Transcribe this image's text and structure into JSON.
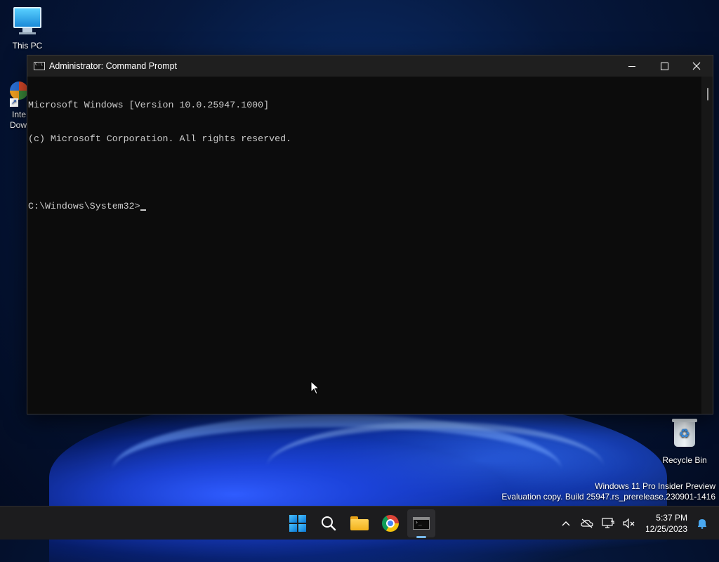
{
  "desktop": {
    "icons": [
      {
        "label": "This PC",
        "icon": "monitor-icon"
      },
      {
        "label": "Recycle Bin",
        "icon": "recycle-bin-icon"
      }
    ],
    "partial_icon": {
      "line1": "Inte",
      "line2": "Dow",
      "icon": "app-shortcut-icon"
    },
    "watermark": {
      "line1": "Windows 11 Pro Insider Preview",
      "line2": "Evaluation copy. Build 25947.rs_prerelease.230901-1416"
    }
  },
  "window": {
    "title": "Administrator: Command Prompt",
    "icon": "cmd-icon",
    "controls": {
      "minimize": "minimize-icon",
      "maximize": "maximize-icon",
      "close": "close-icon"
    },
    "console_lines": [
      "Microsoft Windows [Version 10.0.25947.1000]",
      "(c) Microsoft Corporation. All rights reserved.",
      "",
      "C:\\Windows\\System32>"
    ]
  },
  "taskbar": {
    "apps": [
      {
        "name": "Start",
        "icon": "windows-start-icon"
      },
      {
        "name": "Search",
        "icon": "search-icon"
      },
      {
        "name": "File Explorer",
        "icon": "folder-icon"
      },
      {
        "name": "Google Chrome",
        "icon": "chrome-icon"
      },
      {
        "name": "Command Prompt",
        "icon": "terminal-icon",
        "active": true
      }
    ],
    "tray": {
      "icons": [
        "chevron-up-icon",
        "onedrive-offline-icon",
        "network-icon",
        "volume-muted-icon",
        "notification-bell-icon"
      ],
      "time": "5:37 PM",
      "date": "12/25/2023"
    }
  },
  "colors": {
    "console_bg": "#0c0c0c",
    "console_text": "#cccccc",
    "titlebar_bg": "#1f1f1f",
    "taskbar_bg": "#1c1c1e",
    "accent": "#76b9ed"
  }
}
